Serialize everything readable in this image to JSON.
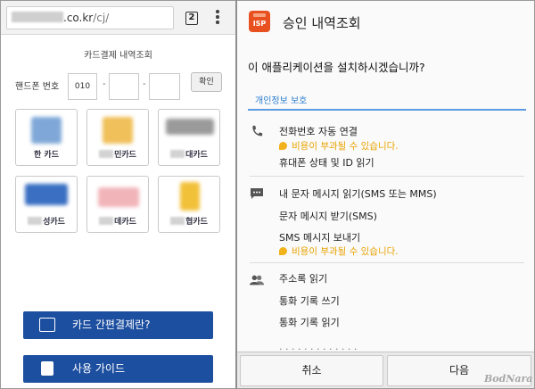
{
  "browser": {
    "url_domain": ".co.kr",
    "url_path": "/cj/",
    "tab_count": "2"
  },
  "left_page": {
    "title": "카드결제 내역조회",
    "phone_label": "핸드폰 번호",
    "phone_prefix": "010",
    "dash": "-",
    "confirm_label": "확인",
    "cards": [
      {
        "name": "한 카드",
        "color": "#7fa8d8"
      },
      {
        "name": "민카드",
        "color": "#f0c05a"
      },
      {
        "name": "대카드",
        "color": "#9a9a9a"
      },
      {
        "name": "성카드",
        "color": "#3a6fc2"
      },
      {
        "name": "데카드",
        "color": "#e8838c"
      },
      {
        "name": "협카드",
        "color": "#f2c13a"
      }
    ],
    "buttons": [
      {
        "label": "카드 간편결제란?",
        "icon": "card-icon"
      },
      {
        "label": "사용 가이드",
        "icon": "book-icon"
      }
    ]
  },
  "dialog": {
    "app_name": "승인 내역조회",
    "app_icon_text": "ISP",
    "question": "이 애플리케이션을 설치하시겠습니까?",
    "section_title": "개인정보 보호",
    "warn_text": "비용이 부과될 수 있습니다.",
    "groups": [
      {
        "icon": "phone-icon",
        "items": [
          "전화번호 자동 연결",
          "휴대폰 상태 및 ID 읽기"
        ]
      },
      {
        "icon": "message-icon",
        "items": [
          "내 문자 메시지 읽기(SMS 또는 MMS)",
          "문자 메시지 받기(SMS)",
          "SMS 메시지 보내기"
        ]
      },
      {
        "icon": "contacts-icon",
        "items": [
          "주소록 읽기",
          "통화 기록 쓰기",
          "통화 기록 읽기"
        ]
      }
    ],
    "cancel_label": "취소",
    "next_label": "다음"
  },
  "watermark": "BodNara"
}
